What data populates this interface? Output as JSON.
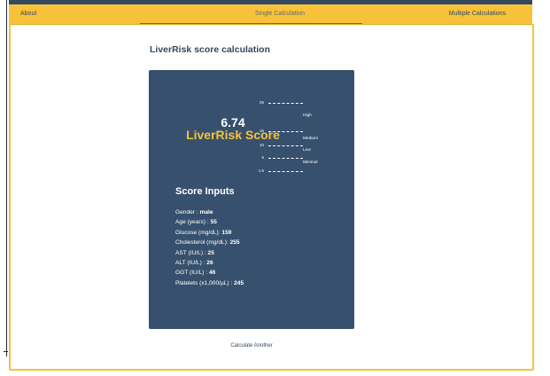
{
  "nav": {
    "about": "About",
    "single": "Single Calculation",
    "multiple": "Multiple Calculations"
  },
  "page": {
    "title": "LiverRisk score calculation"
  },
  "result": {
    "score": "6.74",
    "label": "LiverRisk Score"
  },
  "scale": {
    "ticks": [
      "25",
      "15",
      "10",
      "6",
      "1.5"
    ],
    "bands": [
      "High",
      "Medium",
      "Low",
      "Minimal"
    ]
  },
  "inputs": {
    "title": "Score Inputs",
    "items": [
      {
        "label": "Gender : ",
        "value": "male"
      },
      {
        "label": "Age (years) : ",
        "value": "55"
      },
      {
        "label": "Glucose (mg/dL): ",
        "value": "159"
      },
      {
        "label": "Cholesterol (mg/dL): ",
        "value": "255"
      },
      {
        "label": "AST (IU/L) : ",
        "value": "25"
      },
      {
        "label": "ALT (IU/L) : ",
        "value": "26"
      },
      {
        "label": "GGT (IU/L) : ",
        "value": "46"
      },
      {
        "label": "Platelets (x1,000/µL) : ",
        "value": "245"
      }
    ]
  },
  "actions": {
    "calculate_another": "Calculate Another"
  },
  "colors": {
    "accent": "#f7c23a",
    "card": "#37506d",
    "dark": "#34495e"
  }
}
